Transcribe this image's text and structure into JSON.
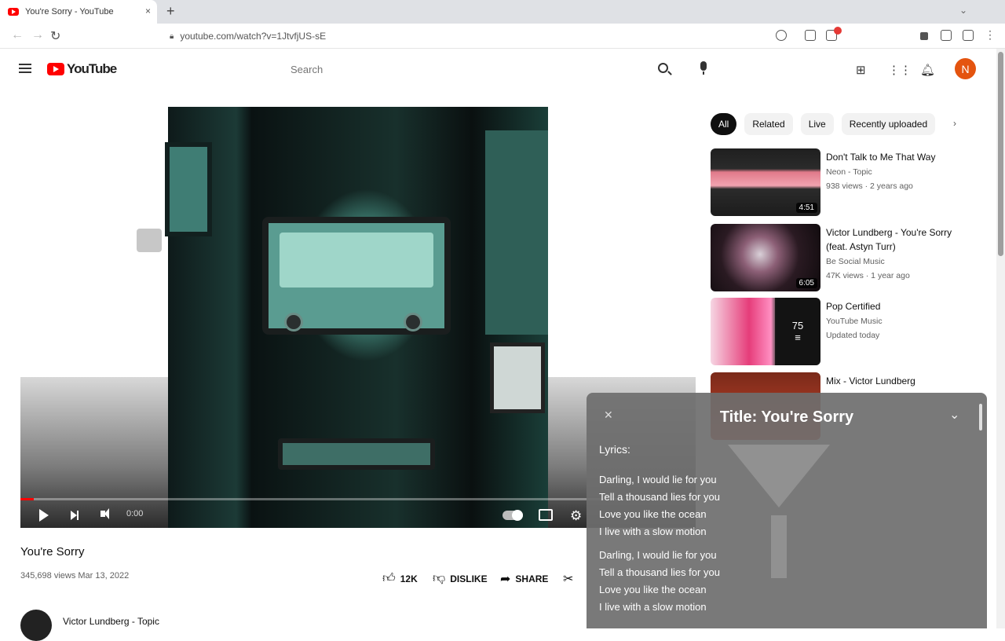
{
  "browser": {
    "tab_title": "You're Sorry - YouTube",
    "tab_close": "×",
    "new_tab": "+",
    "tabbar_menu": "⌄",
    "url": "youtube.com/watch?v=1JtvfjUS-sE"
  },
  "header": {
    "logo_text": "YouTube",
    "search_placeholder": "Search",
    "avatar_letter": "N"
  },
  "player": {
    "time": "0:00",
    "progress_fraction": 0.02
  },
  "video": {
    "title": "You're Sorry",
    "meta": "345,698 views  Mar 13, 2022",
    "like_count": "12K",
    "dislike_label": "DISLIKE",
    "share_label": "SHARE",
    "channel_name": "Victor Lundberg - Topic"
  },
  "chips": [
    "All",
    "Related",
    "Live",
    "Recently uploaded"
  ],
  "recommendations": [
    {
      "title": "Don't Talk to Me That Way",
      "line1": "Neon - Topic",
      "line2": "938 views · 2 years ago",
      "duration": "4:51"
    },
    {
      "title": "Victor Lundberg - You're Sorry (feat. Astyn Turr)",
      "line1": "Be Social Music",
      "line2": "47K views · 1 year ago",
      "duration": "6:05"
    },
    {
      "title": "Pop Certified",
      "line1": "YouTube Music",
      "line2": "Updated today",
      "playlist_count": "75"
    },
    {
      "title": "Mix - Victor Lundberg"
    }
  ],
  "lyrics_panel": {
    "title": "Title: You're Sorry",
    "heading": "Lyrics:",
    "stanzas": [
      [
        "Darling, I would lie for you",
        "Tell a thousand lies for you",
        "Love you like the ocean",
        "I live with a slow motion"
      ],
      [
        "Darling, I would lie for you",
        "Tell a thousand lies for you",
        "Love you like the ocean",
        "I live with a slow motion"
      ]
    ]
  },
  "colors": {
    "brand_red": "#ff0000",
    "avatar_orange": "#e4540f",
    "panel_gray": "#6e6e6e"
  }
}
